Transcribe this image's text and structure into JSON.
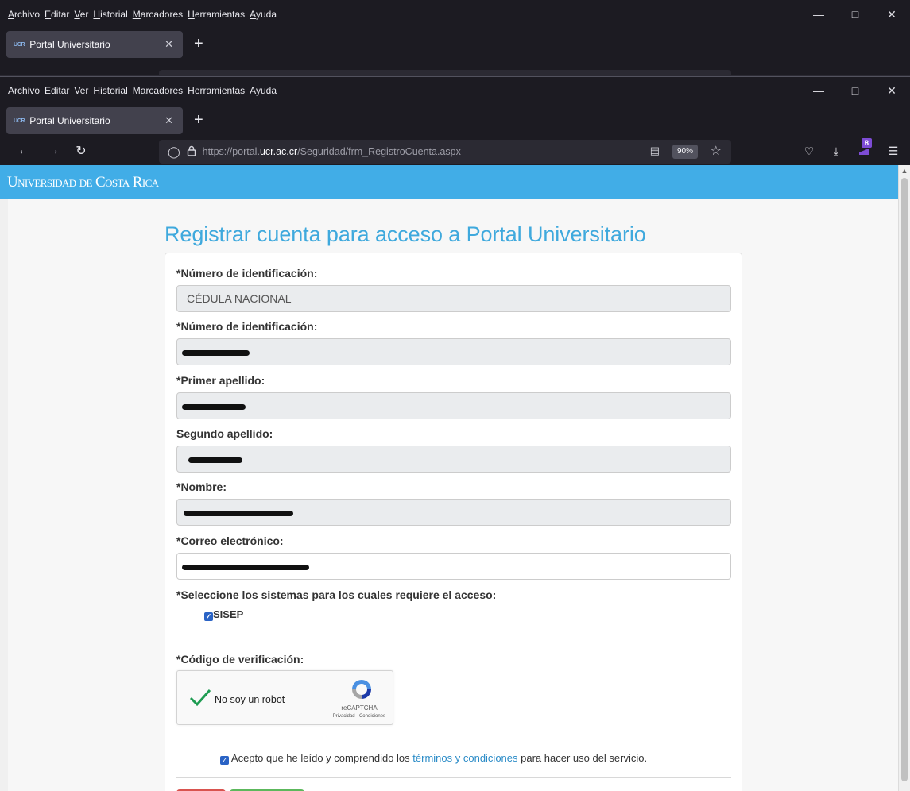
{
  "browser": {
    "menu": [
      "Archivo",
      "Editar",
      "Ver",
      "Historial",
      "Marcadores",
      "Herramientas",
      "Ayuda"
    ],
    "tab_favicon": "UCR",
    "tab_title": "Portal Universitario",
    "url_scheme": "https://portal.",
    "url_host": "ucr.ac.cr",
    "url_path": "/Seguridad/frm_RegistroCuenta.aspx",
    "zoom": "90%",
    "extension_badge": "8"
  },
  "site": {
    "logo_u": "U",
    "logo_niversidad": "NIVERSIDAD",
    "logo_de": "DE",
    "logo_c": "C",
    "logo_osta": "OSTA",
    "logo_r": "R",
    "logo_ica": "ICA"
  },
  "form": {
    "title": "Registrar cuenta para acceso a Portal Universitario",
    "id_type_label": "*Número de identificación:",
    "id_type_value": "CÉDULA NACIONAL",
    "id_number_label": "*Número de identificación:",
    "last_name1_label": "*Primer apellido:",
    "last_name2_label": "Segundo apellido:",
    "name_label": "*Nombre:",
    "email_label": "*Correo electrónico:",
    "systems_label": "*Seleccione los sistemas para los cuales requiere el acceso:",
    "system_option": "SISEP",
    "captcha_label": "*Código de verificación:",
    "captcha_text": "No soy un robot",
    "captcha_brand": "reCAPTCHA",
    "captcha_links": "Privacidad - Condiciones",
    "terms_prefix": "Acepto que he leído y comprendido los ",
    "terms_link": "términos y condiciones",
    "terms_suffix": " para hacer uso del servicio."
  },
  "colors": {
    "brand_blue": "#41ade7",
    "title_blue": "#3fa9dd",
    "button_red": "#d9534f",
    "button_green": "#5cb85c"
  }
}
